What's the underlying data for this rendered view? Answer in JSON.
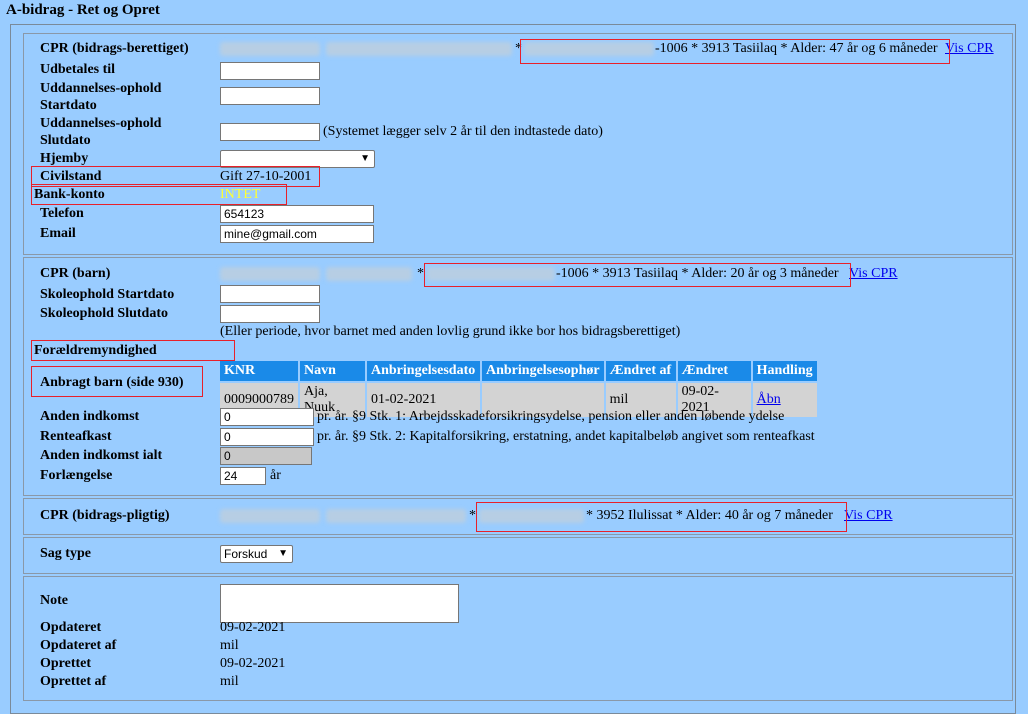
{
  "page_title": "A-bidrag - Ret og Opret",
  "berettiget": {
    "cpr_label": "CPR (bidrags-berettiget)",
    "cpr_value": "-1006 * 3913 Tasiilaq * Alder: 47 år og 6 måneder",
    "vis_cpr": "Vis CPR",
    "udbetales_label": "Udbetales til",
    "udd_start_label_1": "Uddannelses-ophold",
    "udd_start_label_2": "Startdato",
    "udd_slut_label_1": "Uddannelses-ophold",
    "udd_slut_label_2": "Slutdato",
    "udd_slut_hint": "(Systemet lægger selv 2 år til den indtastede dato)",
    "hjemby_label": "Hjemby",
    "hjemby_value": "",
    "civilstand_label": "Civilstand",
    "civilstand_value": "Gift 27-10-2001",
    "bank_label": "Bank-konto",
    "bank_value": "INTET",
    "telefon_label": "Telefon",
    "telefon_value": "654123",
    "email_label": "Email",
    "email_value": "mine@gmail.com"
  },
  "barn": {
    "cpr_label": "CPR (barn)",
    "cpr_value": "-1006 * 3913 Tasiilaq * Alder: 20 år og 3 måneder",
    "vis_cpr": "Vis CPR",
    "skole_start_label": "Skoleophold Startdato",
    "skole_slut_label": "Skoleophold Slutdato",
    "skole_hint": "(Eller periode, hvor barnet med anden lovlig grund ikke bor hos bidragsberettiget)",
    "foraeldre_label": "Forældremyndighed",
    "anbragt_label": "Anbragt barn (side 930)",
    "table_headers": [
      "KNR",
      "Navn",
      "Anbringelsesdato",
      "Anbringelsesophør",
      "Ændret af",
      "Ændret",
      "Handling"
    ],
    "table_rows": [
      [
        "0009000789",
        "Aja, Nuuk",
        "01-02-2021",
        "",
        "mil",
        "09-02-2021",
        "Åbn"
      ]
    ],
    "anden_label": "Anden indkomst",
    "anden_value": "0",
    "anden_hint": "pr. år. §9 Stk. 1: Arbejdsskadeforsikringsydelse, pension eller anden løbende ydelse",
    "rente_label": "Renteafkast",
    "rente_value": "0",
    "rente_hint": "pr. år. §9 Stk. 2: Kapitalforsikring, erstatning, andet kapitalbeløb angivet som renteafkast",
    "ialt_label": "Anden indkomst ialt",
    "ialt_value": "0",
    "forl_label": "Forlængelse",
    "forl_value": "24",
    "forl_unit": "år"
  },
  "pligtig": {
    "cpr_label": "CPR (bidrags-pligtig)",
    "cpr_value": "* 3952 Ilulissat * Alder: 40 år og 7 måneder",
    "vis_cpr": "Vis CPR"
  },
  "sag": {
    "label": "Sag type",
    "value": "Forskud"
  },
  "meta": {
    "note_label": "Note",
    "opdateret_label": "Opdateret",
    "opdateret_value": "09-02-2021",
    "opdateret_af_label": "Opdateret af",
    "opdateret_af_value": "mil",
    "oprettet_label": "Oprettet",
    "oprettet_value": "09-02-2021",
    "oprettet_af_label": "Oprettet af",
    "oprettet_af_value": "mil"
  }
}
